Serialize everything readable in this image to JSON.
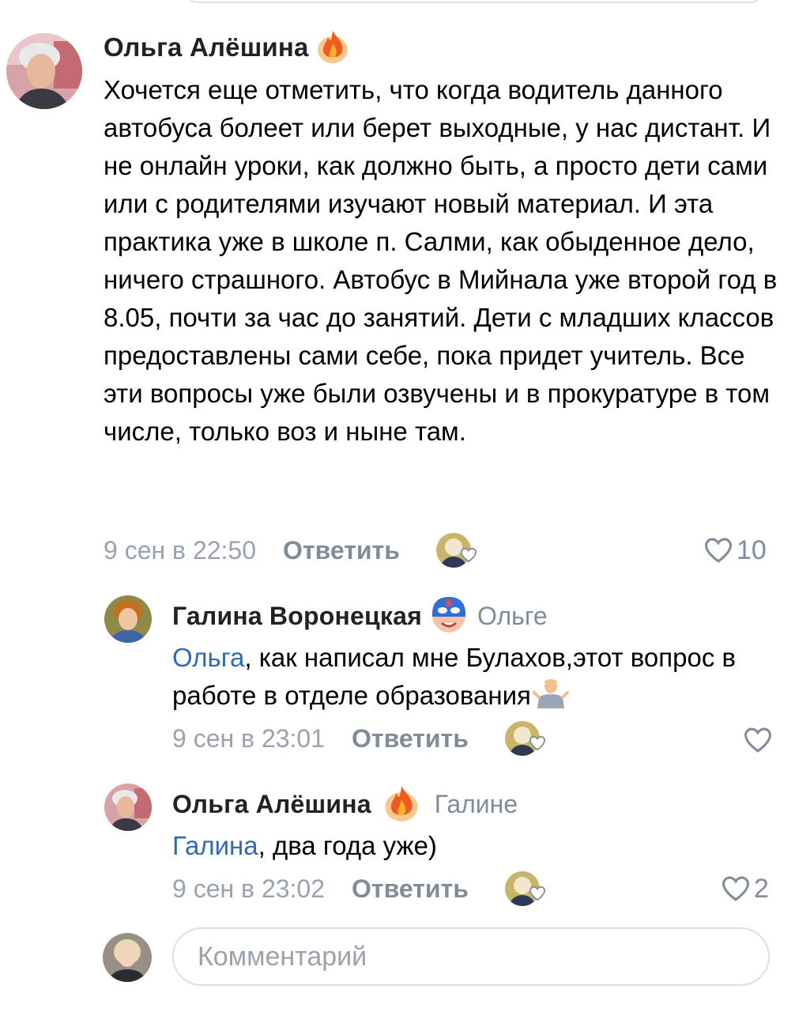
{
  "comments": [
    {
      "author": "Ольга Алёшина",
      "badge_icon": "fire-icon",
      "text": "Хочется еще отметить, что когда водитель данного автобуса болеет или берет выходные, у нас дистант. И не онлайн уроки, как должно быть, а просто дети сами или с родителями изучают новый материал. И эта практика уже в школе п. Салми, как обыденное дело, ничего страшного. Автобус в Мийнала уже второй год в 8.05, почти за час до занятий. Дети с младших классов предоставлены сами себе, пока придет учитель. Все эти вопросы уже были озвучены и в прокуратуре в том числе, только воз и ныне там.",
      "date": "9 сен в 22:50",
      "reply_label": "Ответить",
      "likes": "10"
    },
    {
      "author": "Галина Воронецкая",
      "badge_icon": "superhero-mask-icon",
      "reply_to": "Ольге",
      "mention": "Ольга",
      "text": ", как написал мне Булахов,этот вопрос в работе в отделе образования",
      "trailing_emoji": "shrug-emoji-icon",
      "date": "9 сен в 23:01",
      "reply_label": "Ответить",
      "likes": ""
    },
    {
      "author": "Ольга Алёшина",
      "badge_icon": "fire-icon",
      "reply_to": "Галине",
      "mention": "Галина",
      "text": ", два года уже)",
      "date": "9 сен в 23:02",
      "reply_label": "Ответить",
      "likes": "2"
    }
  ],
  "composer": {
    "placeholder": "Комментарий"
  },
  "colors": {
    "link": "#2d6bb5",
    "secondary": "#818c99",
    "date": "#99a2ad"
  }
}
